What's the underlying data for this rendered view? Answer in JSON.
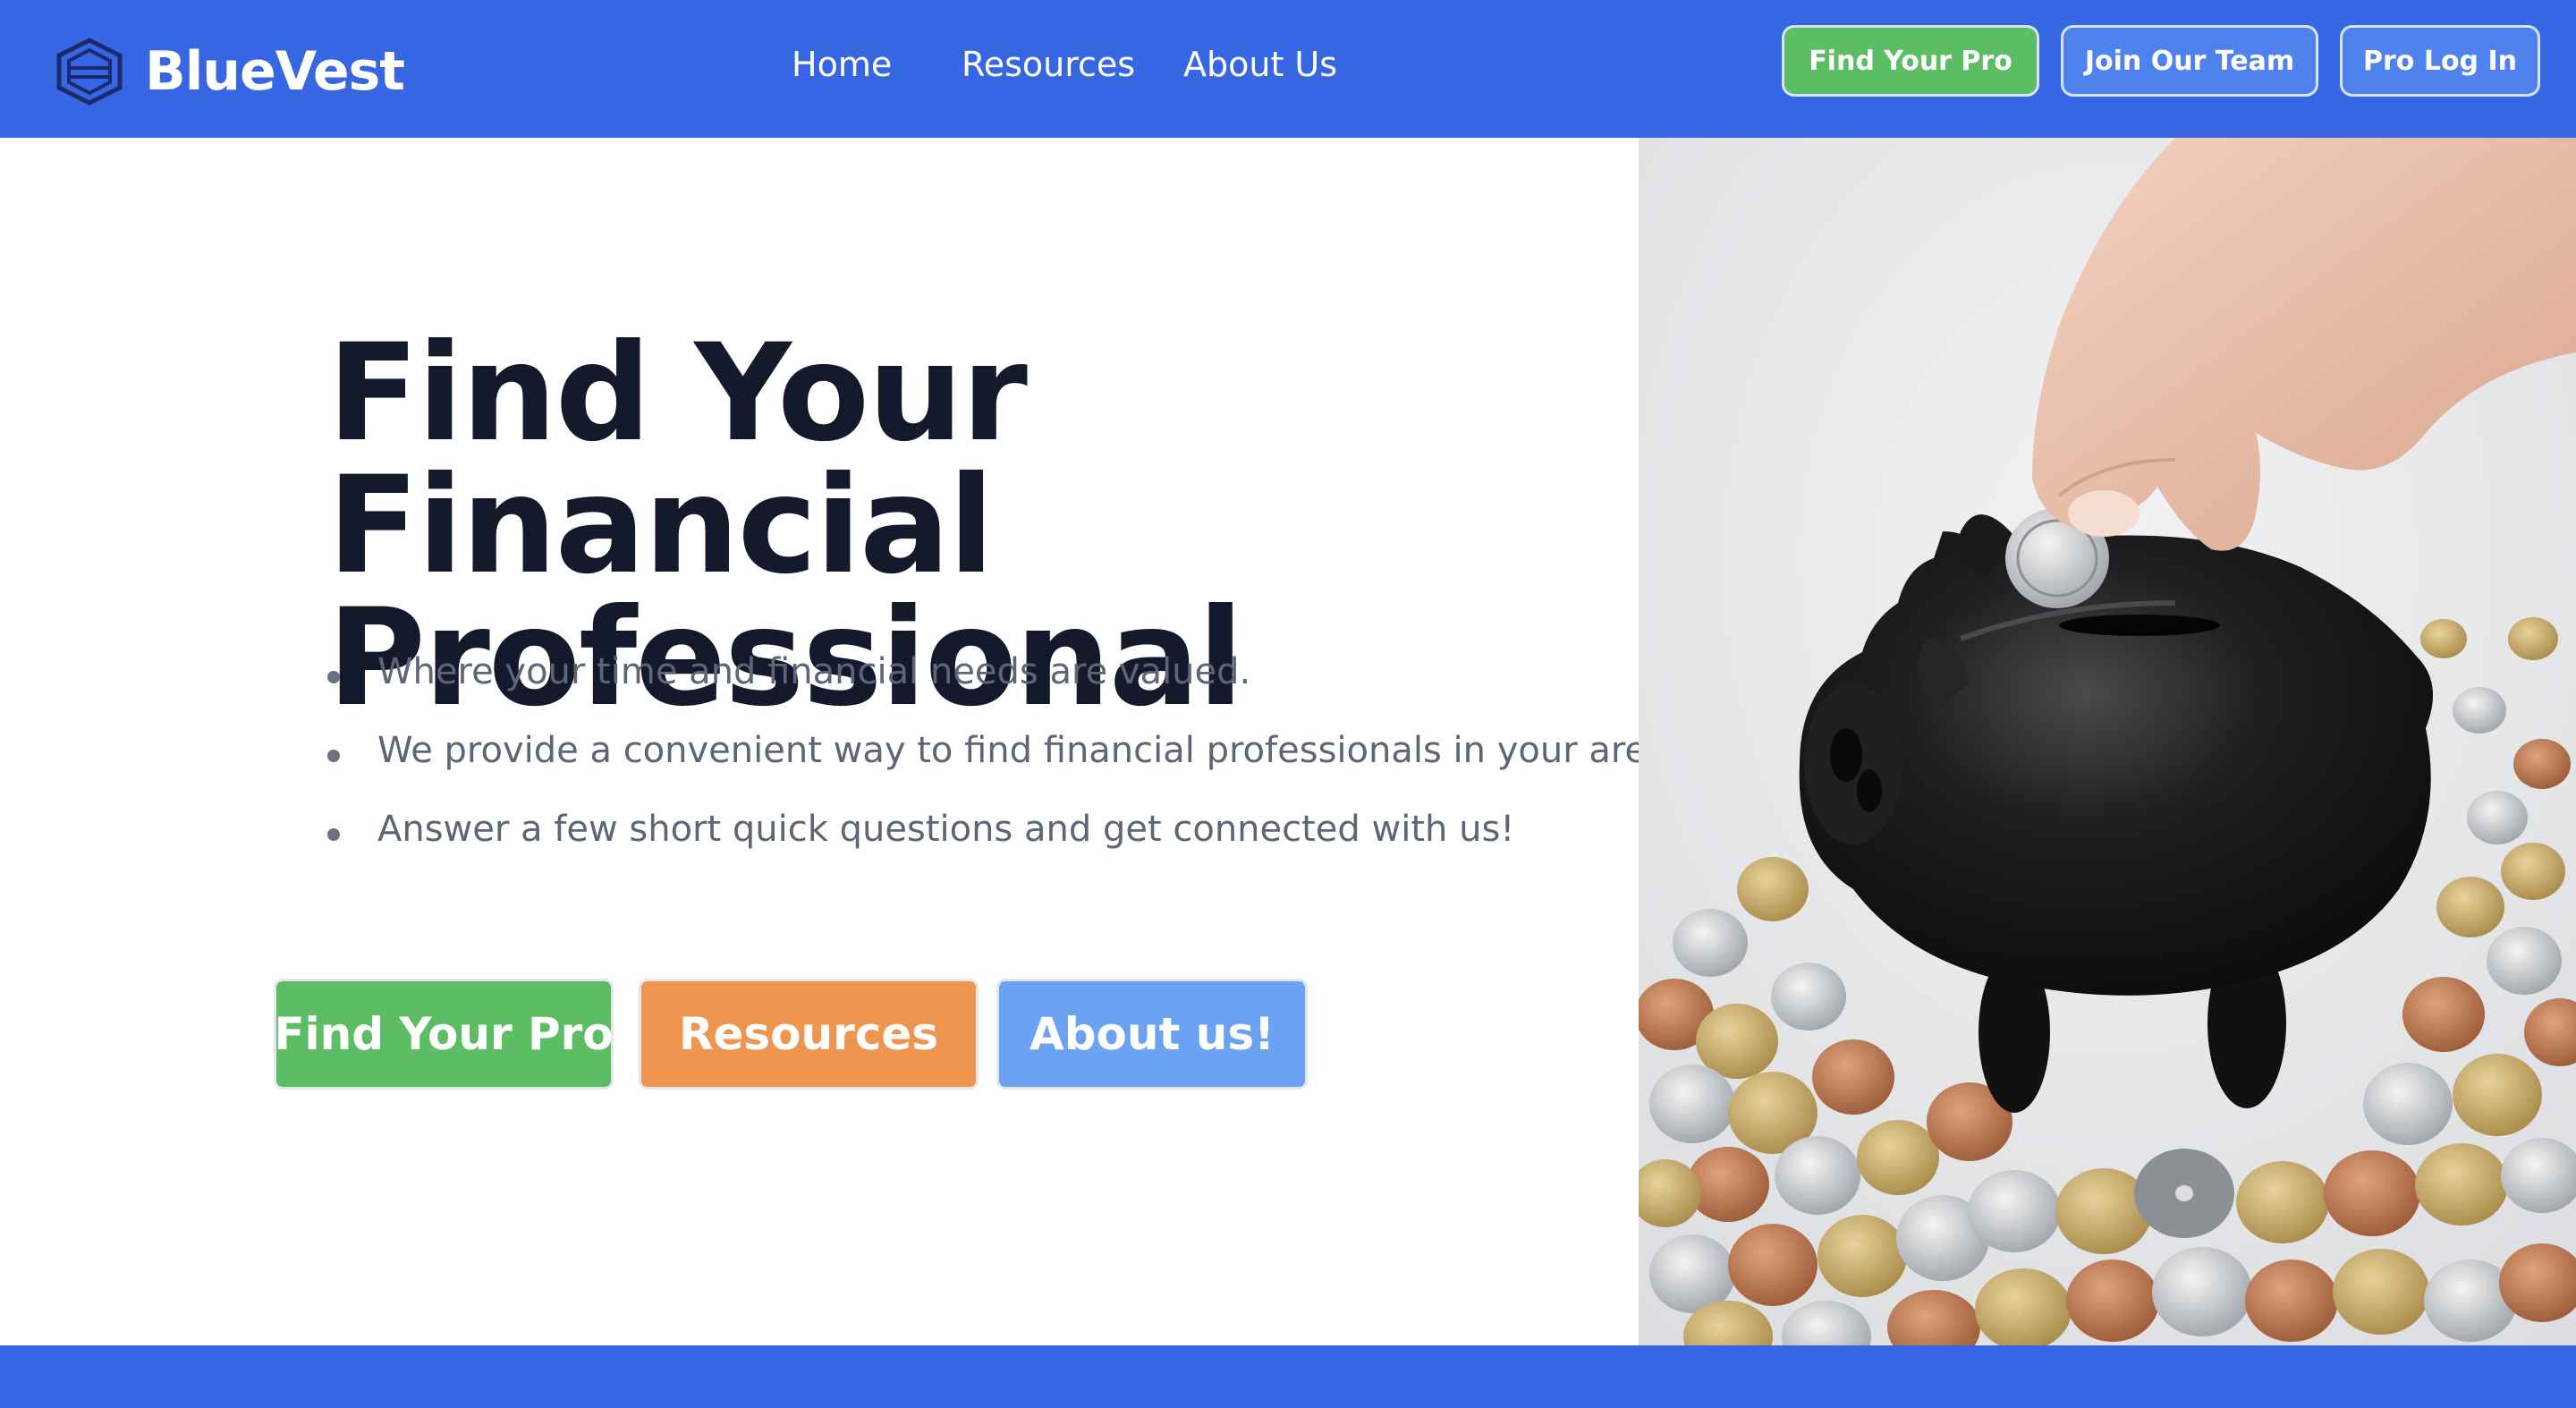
{
  "header": {
    "brand": "BlueVest",
    "nav": {
      "home": "Home",
      "resources": "Resources",
      "about": "About Us"
    },
    "buttons": {
      "find_pro": "Find Your Pro",
      "join_team": "Join Our Team",
      "pro_login": "Pro Log In"
    }
  },
  "hero": {
    "title_line1": "Find Your Financial",
    "title_line2": "Professional",
    "bullets": [
      "Where your time and financial needs are valued.",
      "We provide a convenient way to find financial professionals in your area.",
      "Answer a few short quick questions and get connected with us!"
    ],
    "cta": {
      "find_pro": "Find Your Pro",
      "resources": "Resources",
      "about": "About us!"
    }
  },
  "colors": {
    "brand_blue": "#3766e3",
    "green": "#5cbd64",
    "orange": "#ee954f",
    "light_blue": "#6ba2f2",
    "title": "#141a2b"
  },
  "icons": {
    "logo": "hexagon-logo-icon"
  }
}
